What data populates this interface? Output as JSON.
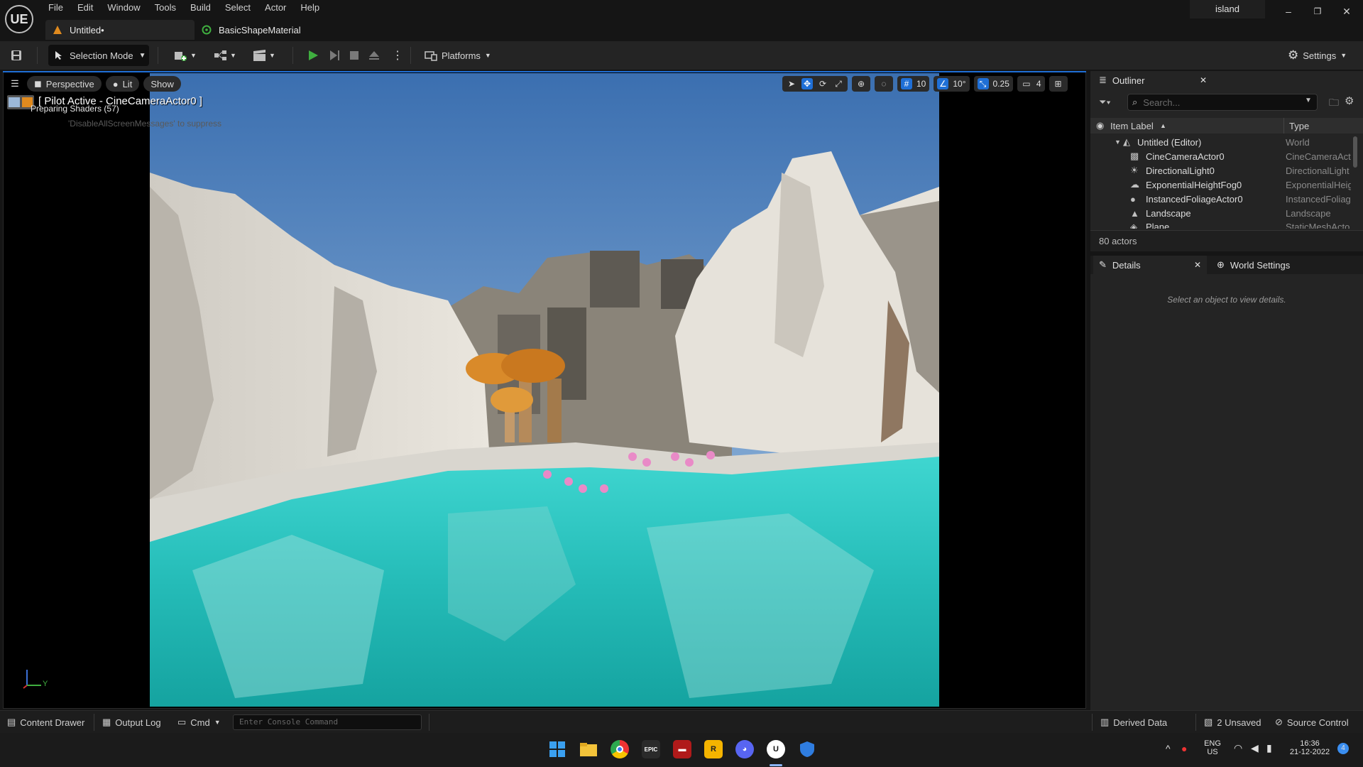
{
  "app": {
    "logo": "UE",
    "project_name": "island",
    "menu": [
      "File",
      "Edit",
      "Window",
      "Tools",
      "Build",
      "Select",
      "Actor",
      "Help"
    ],
    "tabs": [
      {
        "label": "Untitled•",
        "icon": "level-icon",
        "active": true
      },
      {
        "label": "BasicShapeMaterial",
        "icon": "material-icon",
        "active": false
      }
    ],
    "window_controls": {
      "minimize": "–",
      "restore": "❐",
      "close": "✕"
    }
  },
  "toolbar": {
    "selection_mode": "Selection Mode",
    "platforms": "Platforms",
    "settings": "Settings"
  },
  "viewport": {
    "view_mode": "Perspective",
    "lighting": "Lit",
    "show": "Show",
    "pilot_label": "[ Pilot Active - CineCameraActor0 ]",
    "status": "Preparing Shaders (57)",
    "suppress_hint": "'DisableAllScreenMessages' to suppress",
    "grid_snap": "10",
    "rotation_snap": "10°",
    "scale_snap": "0.25",
    "camera_speed": "4",
    "axis_y": "Y"
  },
  "outliner": {
    "title": "Outliner",
    "search_placeholder": "Search...",
    "col_label": "Item Label",
    "col_type": "Type",
    "rows": [
      {
        "label": "Untitled (Editor)",
        "type": "World",
        "icon": "level-icon"
      },
      {
        "label": "CineCameraActor0",
        "type": "CineCameraAct",
        "icon": "camera-icon"
      },
      {
        "label": "DirectionalLight0",
        "type": "DirectionalLight",
        "icon": "sun-icon"
      },
      {
        "label": "ExponentialHeightFog0",
        "type": "ExponentialHeig",
        "icon": "fog-icon"
      },
      {
        "label": "InstancedFoliageActor0",
        "type": "InstancedFoliag",
        "icon": "foliage-icon"
      },
      {
        "label": "Landscape",
        "type": "Landscape",
        "icon": "landscape-icon"
      },
      {
        "label": "Plane",
        "type": "StaticMeshActo",
        "icon": "mesh-icon"
      }
    ],
    "actor_count": "80 actors"
  },
  "details": {
    "tab_details": "Details",
    "tab_world": "World Settings",
    "empty_message": "Select an object to view details."
  },
  "statusbar": {
    "content_drawer": "Content Drawer",
    "output_log": "Output Log",
    "cmd": "Cmd",
    "console_placeholder": "Enter Console Command",
    "derived_data": "Derived Data",
    "unsaved": "2 Unsaved",
    "source_control": "Source Control"
  },
  "taskbar": {
    "lang": "ENG",
    "region": "US",
    "time": "16:36",
    "date": "21-12-2022",
    "notifications": "4",
    "icons": [
      "windows-start-icon",
      "file-explorer-icon",
      "chrome-icon",
      "epic-games-icon",
      "red-app-icon",
      "rockstar-icon",
      "discord-icon",
      "unreal-icon",
      "defender-icon"
    ]
  },
  "colors": {
    "accent": "#1f6fd6",
    "play_green": "#3fae3f",
    "warning_orange": "#e08a1e"
  }
}
